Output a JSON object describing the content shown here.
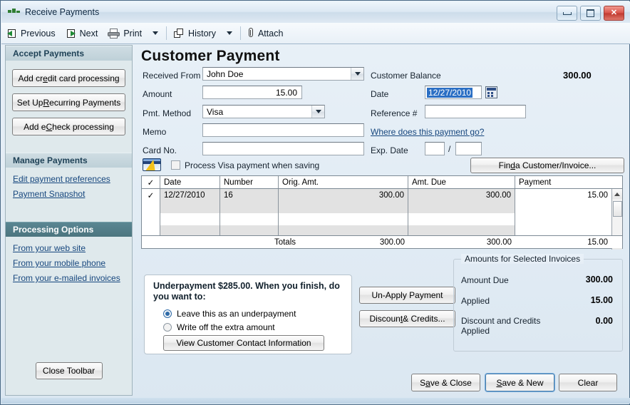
{
  "window": {
    "title": "Receive Payments",
    "controls": {
      "minimize": "minimize-button",
      "restore": "restore-button",
      "close": "close-button"
    }
  },
  "toolbar": {
    "previous": "Previous",
    "next": "Next",
    "print": "Print",
    "history": "History",
    "attach": "Attach"
  },
  "sidebar": {
    "accept": {
      "header": "Accept Payments",
      "buttons": [
        {
          "pre": "Add cr",
          "accel": "e",
          "post": "dit card processing"
        },
        {
          "pre": "Set Up ",
          "accel": "R",
          "post": "ecurring Payments"
        },
        {
          "pre": "Add e",
          "accel": "C",
          "post": "heck processing"
        }
      ]
    },
    "manage": {
      "header": "Manage Payments",
      "links": [
        "Edit payment preferences",
        "Payment Snapshot"
      ]
    },
    "processing": {
      "header": "Processing Options",
      "links": [
        "From your web site",
        "From your mobile phone",
        "From your e-mailed invoices"
      ]
    },
    "close_toolbar": "Close Toolbar"
  },
  "form": {
    "page_title": "Customer Payment",
    "received_from_label": "Received From",
    "received_from_value": "John Doe",
    "amount_label": "Amount",
    "amount_value": "15.00",
    "pmt_method_label": "Pmt. Method",
    "pmt_method_value": "Visa",
    "memo_label": "Memo",
    "memo_value": "",
    "card_no_label": "Card No.",
    "card_no_value": "",
    "process_checkbox_label": "Process Visa payment when saving",
    "process_checkbox_checked": false,
    "customer_balance_label": "Customer Balance",
    "customer_balance_value": "300.00",
    "date_label": "Date",
    "date_value": "12/27/2010",
    "reference_label": "Reference #",
    "reference_value": "",
    "where_link": "Where does this payment go?",
    "exp_date_label": "Exp. Date",
    "exp_month_value": "",
    "exp_year_value": "",
    "exp_separator": "/",
    "find_button": {
      "pre": "Fin",
      "accel": "d",
      "post": " a Customer/Invoice..."
    }
  },
  "invoice_table": {
    "columns": [
      "✓",
      "Date",
      "Number",
      "Orig. Amt.",
      "Amt. Due",
      "Payment"
    ],
    "rows": [
      {
        "check": "✓",
        "date": "12/27/2010",
        "number": "16",
        "orig": "300.00",
        "due": "300.00",
        "payment": "15.00"
      }
    ],
    "totals_label": "Totals",
    "totals": {
      "orig": "300.00",
      "due": "300.00",
      "payment": "15.00"
    }
  },
  "underpayment": {
    "title": "Underpayment $285.00. When you finish, do you want to:",
    "option_leave": "Leave this as an underpayment",
    "option_writeoff": "Write off the extra amount",
    "selected": "leave",
    "view_contact_button": "View Customer Contact Information"
  },
  "actions": {
    "un_apply": "Un-Apply Payment",
    "discount": {
      "pre": "Discoun",
      "accel": "t",
      "post": " & Credits..."
    }
  },
  "amounts_panel": {
    "legend": "Amounts for Selected Invoices",
    "rows": [
      {
        "label": "Amount Due",
        "value": "300.00"
      },
      {
        "label": "Applied",
        "value": "15.00"
      },
      {
        "label": "Discount and Credits Applied",
        "value": "0.00"
      }
    ]
  },
  "footer": {
    "save_close": {
      "pre": "S",
      "accel": "a",
      "post": "ve & Close"
    },
    "save_new": {
      "pre": "",
      "accel": "S",
      "post": "ave & New"
    },
    "clear": "Clear"
  }
}
